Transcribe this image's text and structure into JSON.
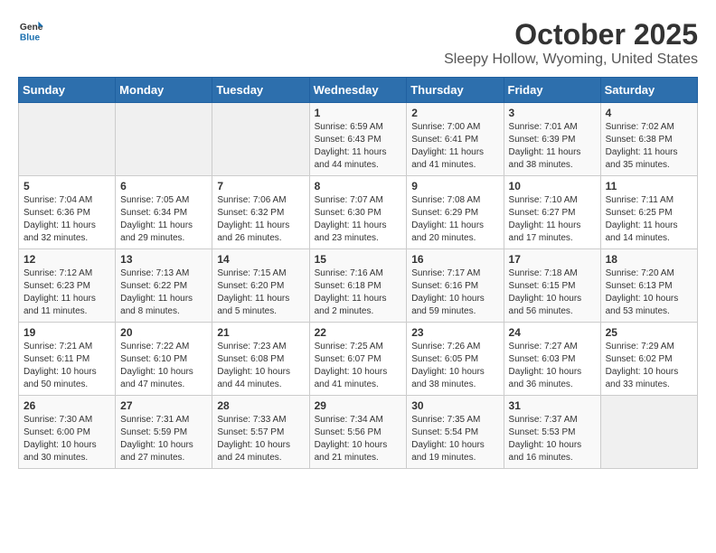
{
  "logo": {
    "general": "General",
    "blue": "Blue"
  },
  "title": "October 2025",
  "subtitle": "Sleepy Hollow, Wyoming, United States",
  "weekdays": [
    "Sunday",
    "Monday",
    "Tuesday",
    "Wednesday",
    "Thursday",
    "Friday",
    "Saturday"
  ],
  "weeks": [
    [
      {
        "day": "",
        "sunrise": "",
        "sunset": "",
        "daylight": "",
        "empty": true
      },
      {
        "day": "",
        "sunrise": "",
        "sunset": "",
        "daylight": "",
        "empty": true
      },
      {
        "day": "",
        "sunrise": "",
        "sunset": "",
        "daylight": "",
        "empty": true
      },
      {
        "day": "1",
        "sunrise": "Sunrise: 6:59 AM",
        "sunset": "Sunset: 6:43 PM",
        "daylight": "Daylight: 11 hours and 44 minutes."
      },
      {
        "day": "2",
        "sunrise": "Sunrise: 7:00 AM",
        "sunset": "Sunset: 6:41 PM",
        "daylight": "Daylight: 11 hours and 41 minutes."
      },
      {
        "day": "3",
        "sunrise": "Sunrise: 7:01 AM",
        "sunset": "Sunset: 6:39 PM",
        "daylight": "Daylight: 11 hours and 38 minutes."
      },
      {
        "day": "4",
        "sunrise": "Sunrise: 7:02 AM",
        "sunset": "Sunset: 6:38 PM",
        "daylight": "Daylight: 11 hours and 35 minutes."
      }
    ],
    [
      {
        "day": "5",
        "sunrise": "Sunrise: 7:04 AM",
        "sunset": "Sunset: 6:36 PM",
        "daylight": "Daylight: 11 hours and 32 minutes."
      },
      {
        "day": "6",
        "sunrise": "Sunrise: 7:05 AM",
        "sunset": "Sunset: 6:34 PM",
        "daylight": "Daylight: 11 hours and 29 minutes."
      },
      {
        "day": "7",
        "sunrise": "Sunrise: 7:06 AM",
        "sunset": "Sunset: 6:32 PM",
        "daylight": "Daylight: 11 hours and 26 minutes."
      },
      {
        "day": "8",
        "sunrise": "Sunrise: 7:07 AM",
        "sunset": "Sunset: 6:30 PM",
        "daylight": "Daylight: 11 hours and 23 minutes."
      },
      {
        "day": "9",
        "sunrise": "Sunrise: 7:08 AM",
        "sunset": "Sunset: 6:29 PM",
        "daylight": "Daylight: 11 hours and 20 minutes."
      },
      {
        "day": "10",
        "sunrise": "Sunrise: 7:10 AM",
        "sunset": "Sunset: 6:27 PM",
        "daylight": "Daylight: 11 hours and 17 minutes."
      },
      {
        "day": "11",
        "sunrise": "Sunrise: 7:11 AM",
        "sunset": "Sunset: 6:25 PM",
        "daylight": "Daylight: 11 hours and 14 minutes."
      }
    ],
    [
      {
        "day": "12",
        "sunrise": "Sunrise: 7:12 AM",
        "sunset": "Sunset: 6:23 PM",
        "daylight": "Daylight: 11 hours and 11 minutes."
      },
      {
        "day": "13",
        "sunrise": "Sunrise: 7:13 AM",
        "sunset": "Sunset: 6:22 PM",
        "daylight": "Daylight: 11 hours and 8 minutes."
      },
      {
        "day": "14",
        "sunrise": "Sunrise: 7:15 AM",
        "sunset": "Sunset: 6:20 PM",
        "daylight": "Daylight: 11 hours and 5 minutes."
      },
      {
        "day": "15",
        "sunrise": "Sunrise: 7:16 AM",
        "sunset": "Sunset: 6:18 PM",
        "daylight": "Daylight: 11 hours and 2 minutes."
      },
      {
        "day": "16",
        "sunrise": "Sunrise: 7:17 AM",
        "sunset": "Sunset: 6:16 PM",
        "daylight": "Daylight: 10 hours and 59 minutes."
      },
      {
        "day": "17",
        "sunrise": "Sunrise: 7:18 AM",
        "sunset": "Sunset: 6:15 PM",
        "daylight": "Daylight: 10 hours and 56 minutes."
      },
      {
        "day": "18",
        "sunrise": "Sunrise: 7:20 AM",
        "sunset": "Sunset: 6:13 PM",
        "daylight": "Daylight: 10 hours and 53 minutes."
      }
    ],
    [
      {
        "day": "19",
        "sunrise": "Sunrise: 7:21 AM",
        "sunset": "Sunset: 6:11 PM",
        "daylight": "Daylight: 10 hours and 50 minutes."
      },
      {
        "day": "20",
        "sunrise": "Sunrise: 7:22 AM",
        "sunset": "Sunset: 6:10 PM",
        "daylight": "Daylight: 10 hours and 47 minutes."
      },
      {
        "day": "21",
        "sunrise": "Sunrise: 7:23 AM",
        "sunset": "Sunset: 6:08 PM",
        "daylight": "Daylight: 10 hours and 44 minutes."
      },
      {
        "day": "22",
        "sunrise": "Sunrise: 7:25 AM",
        "sunset": "Sunset: 6:07 PM",
        "daylight": "Daylight: 10 hours and 41 minutes."
      },
      {
        "day": "23",
        "sunrise": "Sunrise: 7:26 AM",
        "sunset": "Sunset: 6:05 PM",
        "daylight": "Daylight: 10 hours and 38 minutes."
      },
      {
        "day": "24",
        "sunrise": "Sunrise: 7:27 AM",
        "sunset": "Sunset: 6:03 PM",
        "daylight": "Daylight: 10 hours and 36 minutes."
      },
      {
        "day": "25",
        "sunrise": "Sunrise: 7:29 AM",
        "sunset": "Sunset: 6:02 PM",
        "daylight": "Daylight: 10 hours and 33 minutes."
      }
    ],
    [
      {
        "day": "26",
        "sunrise": "Sunrise: 7:30 AM",
        "sunset": "Sunset: 6:00 PM",
        "daylight": "Daylight: 10 hours and 30 minutes."
      },
      {
        "day": "27",
        "sunrise": "Sunrise: 7:31 AM",
        "sunset": "Sunset: 5:59 PM",
        "daylight": "Daylight: 10 hours and 27 minutes."
      },
      {
        "day": "28",
        "sunrise": "Sunrise: 7:33 AM",
        "sunset": "Sunset: 5:57 PM",
        "daylight": "Daylight: 10 hours and 24 minutes."
      },
      {
        "day": "29",
        "sunrise": "Sunrise: 7:34 AM",
        "sunset": "Sunset: 5:56 PM",
        "daylight": "Daylight: 10 hours and 21 minutes."
      },
      {
        "day": "30",
        "sunrise": "Sunrise: 7:35 AM",
        "sunset": "Sunset: 5:54 PM",
        "daylight": "Daylight: 10 hours and 19 minutes."
      },
      {
        "day": "31",
        "sunrise": "Sunrise: 7:37 AM",
        "sunset": "Sunset: 5:53 PM",
        "daylight": "Daylight: 10 hours and 16 minutes."
      },
      {
        "day": "",
        "sunrise": "",
        "sunset": "",
        "daylight": "",
        "empty": true
      }
    ]
  ]
}
